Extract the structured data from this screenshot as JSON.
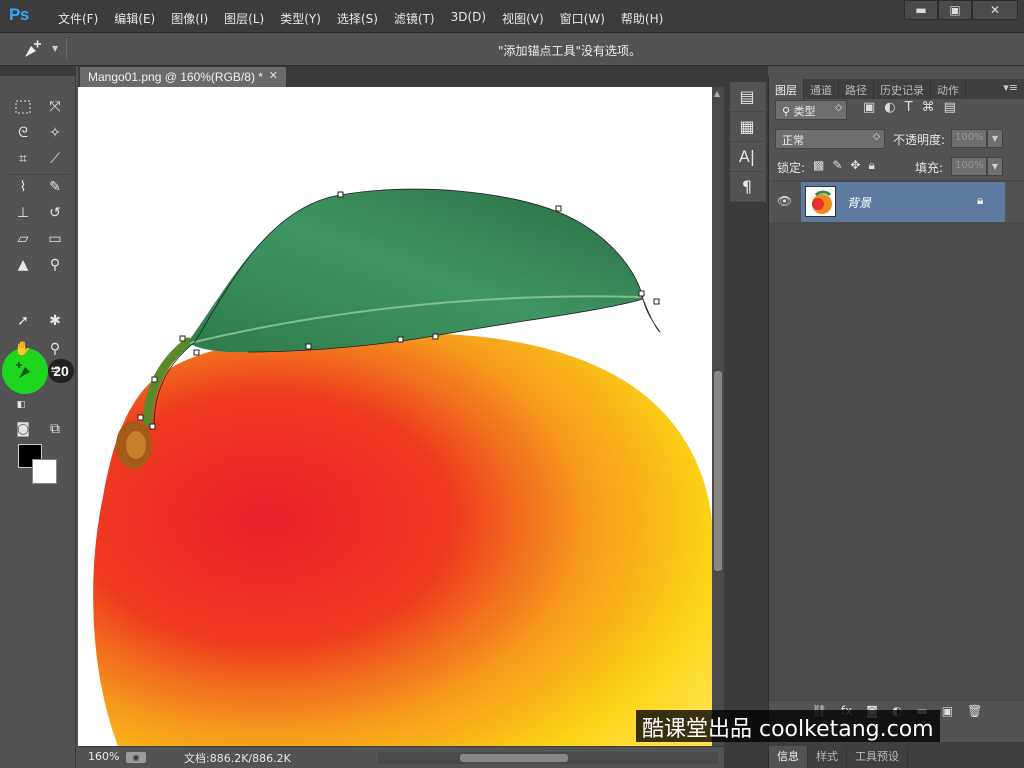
{
  "app": {
    "logo": "Ps"
  },
  "menu": [
    "文件(F)",
    "编辑(E)",
    "图像(I)",
    "图层(L)",
    "类型(Y)",
    "选择(S)",
    "滤镜(T)",
    "3D(D)",
    "视图(V)",
    "窗口(W)",
    "帮助(H)"
  ],
  "window_controls": {
    "minimize": "▬",
    "maximize": "▣",
    "close": "✕"
  },
  "options_bar": {
    "message": "\"添加锚点工具\"没有选项。"
  },
  "document": {
    "tab_title": "Mango01.png @ 160%(RGB/8) *",
    "close": "✕"
  },
  "tools": {
    "highlight_badge": "20"
  },
  "status": {
    "zoom": "160%",
    "doc_info": "文档:886.2K/886.2K"
  },
  "layers_panel": {
    "tabs": [
      "图层",
      "通道",
      "路径",
      "历史记录",
      "动作"
    ],
    "active_tab": "图层",
    "filter_label": "类型",
    "blend_mode": "正常",
    "opacity_label": "不透明度:",
    "opacity_value": "100%",
    "lock_label": "锁定:",
    "fill_label": "填充:",
    "fill_value": "100%",
    "layers": [
      {
        "name": "背景",
        "locked": true,
        "visible": true,
        "selected": true
      }
    ]
  },
  "bottom_tabs": [
    "信息",
    "样式",
    "工具预设"
  ],
  "watermark": "酷课堂出品 coolketang.com",
  "colors": {
    "accent": "#31a8ff",
    "highlight": "#1ed61e",
    "selected_layer": "#5d7aa1"
  }
}
